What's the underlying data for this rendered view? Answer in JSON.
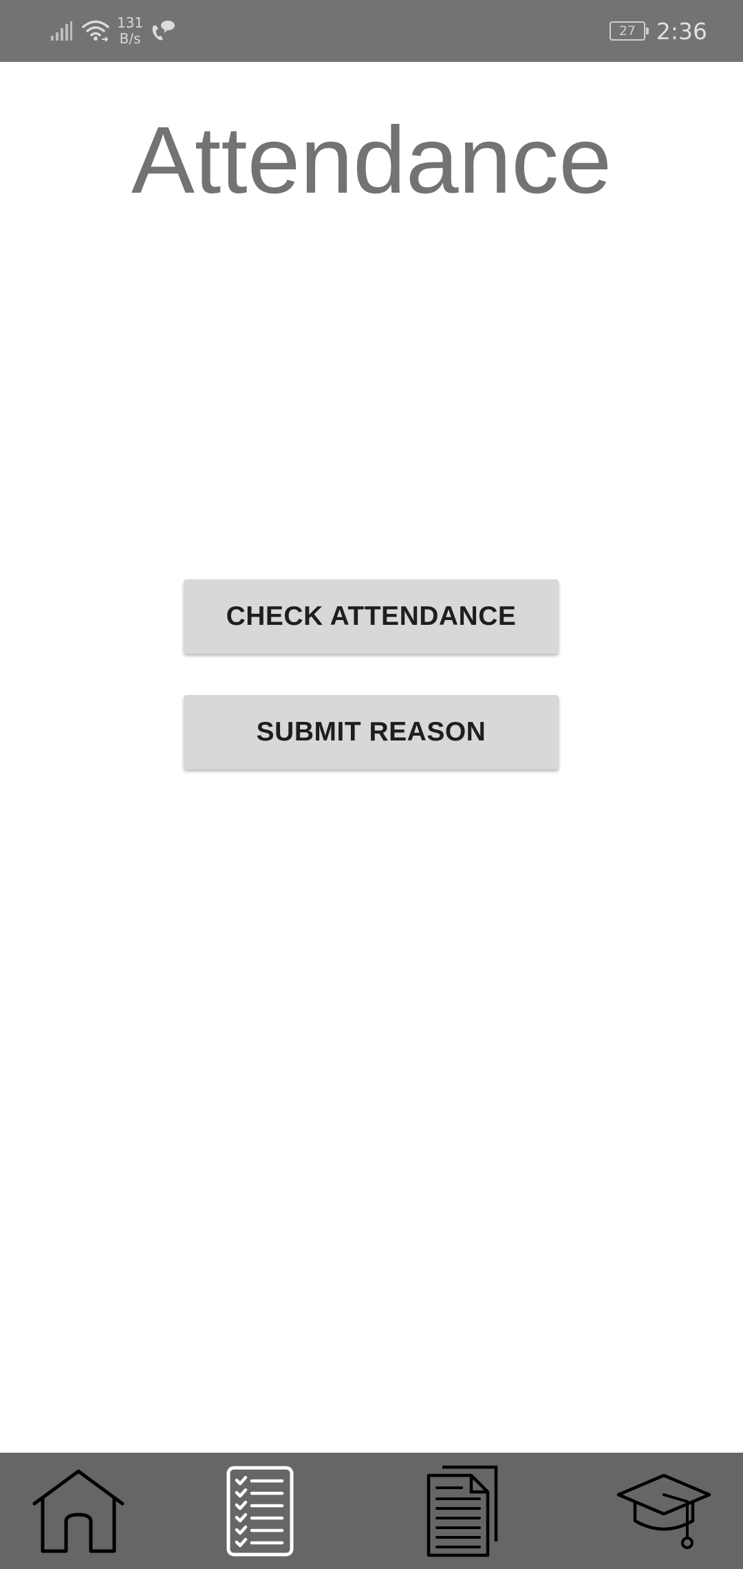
{
  "status_bar": {
    "net_speed_value": "131",
    "net_speed_unit": "B/s",
    "battery_level": "27",
    "time": "2:36"
  },
  "header": {
    "title": "Attendance"
  },
  "actions": {
    "check_attendance_label": "CHECK ATTENDANCE",
    "submit_reason_label": "SUBMIT REASON"
  },
  "bottom_nav": {
    "items": [
      {
        "icon": "home-icon",
        "selected": false
      },
      {
        "icon": "checklist-icon",
        "selected": true
      },
      {
        "icon": "documents-icon",
        "selected": false
      },
      {
        "icon": "graduation-cap-icon",
        "selected": false
      }
    ]
  },
  "colors": {
    "status_bar_bg": "#737373",
    "bottom_nav_bg": "#666666",
    "title_text": "#737373",
    "button_bg": "#d7d8d8",
    "button_text": "#1e1e1e",
    "selected_nav_icon": "#ffffff"
  }
}
